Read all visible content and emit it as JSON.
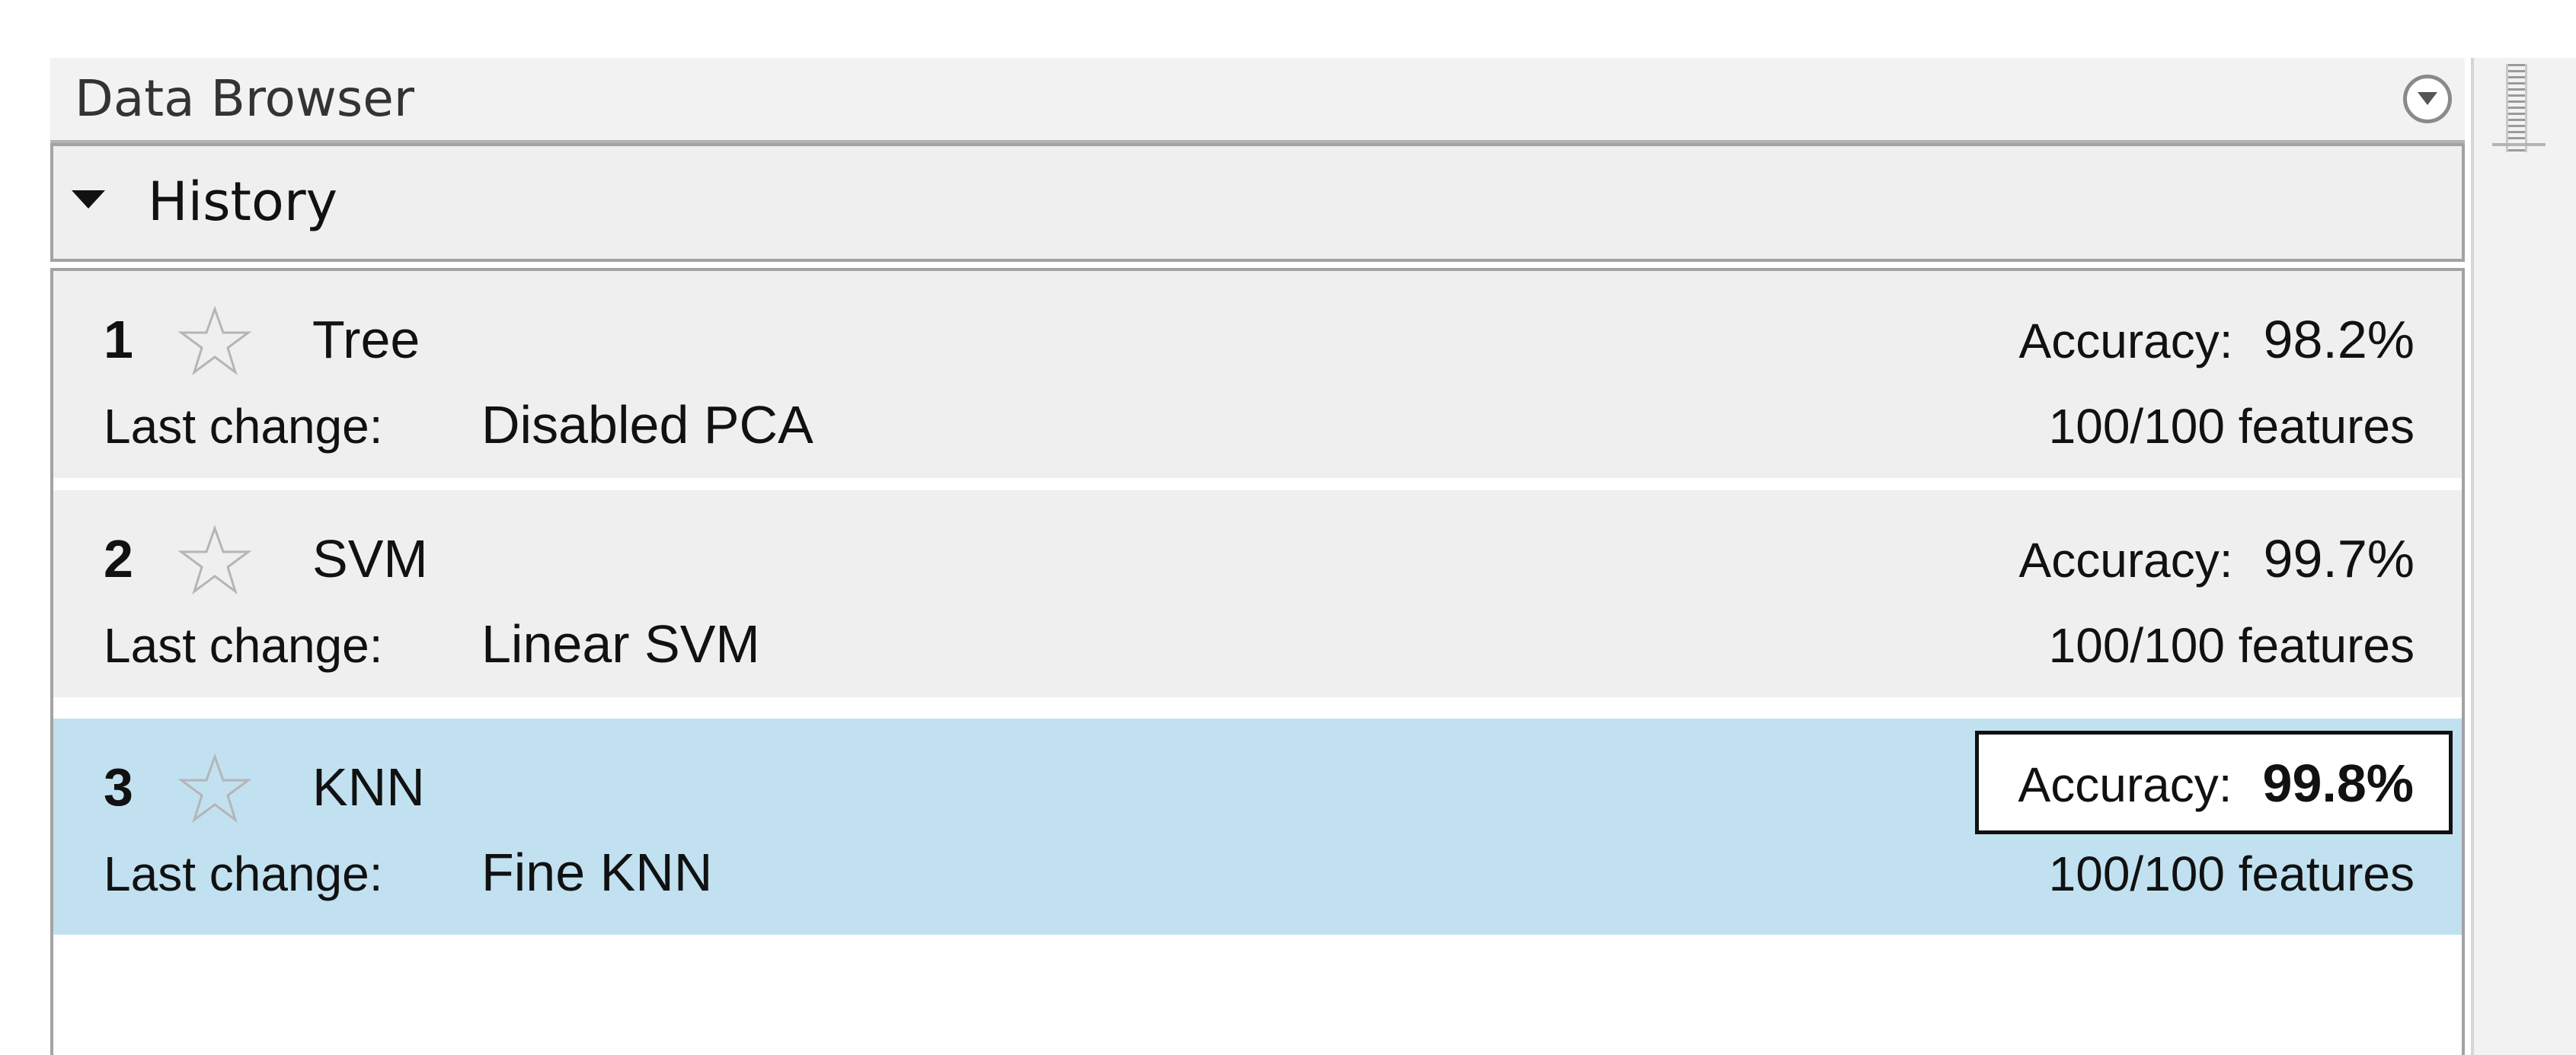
{
  "panel": {
    "title": "Data Browser",
    "menu_icon": "circle-down-arrow-icon"
  },
  "history_section": {
    "label": "History",
    "expanded": true,
    "expander_icon": "triangle-down-icon"
  },
  "history": {
    "items": [
      {
        "number": "1",
        "model": "Tree",
        "star_icon": "star-outline-icon",
        "last_change_label": "Last change:",
        "last_change": "Disabled PCA",
        "accuracy_label": "Accuracy:",
        "accuracy": "98.2%",
        "features": "100/100 features",
        "selected": false
      },
      {
        "number": "2",
        "model": "SVM",
        "star_icon": "star-outline-icon",
        "last_change_label": "Last change:",
        "last_change": "Linear SVM",
        "accuracy_label": "Accuracy:",
        "accuracy": "99.7%",
        "features": "100/100 features",
        "selected": false
      },
      {
        "number": "3",
        "model": "KNN",
        "star_icon": "star-outline-icon",
        "last_change_label": "Last change:",
        "last_change": "Fine KNN",
        "accuracy_label": "Accuracy:",
        "accuracy": "99.8%",
        "features": "100/100 features",
        "selected": true,
        "best_accuracy": true
      }
    ]
  },
  "colors": {
    "selected_row": "#c1e1f1",
    "row_background": "#efefef",
    "panel_background": "#f2f2f2"
  }
}
